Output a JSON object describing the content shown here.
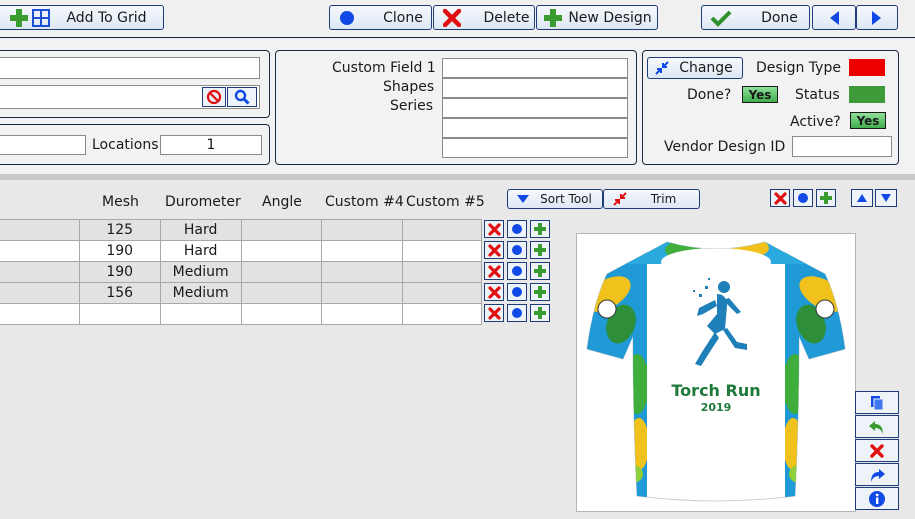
{
  "toolbar": {
    "add_to_grid": "Add To Grid",
    "clone": "Clone",
    "delete": "Delete",
    "new_design": "New Design",
    "done": "Done"
  },
  "form": {
    "locations_label": "Locations",
    "locations_value": "1",
    "custom_field_1_label": "Custom Field 1",
    "shapes_label": "Shapes",
    "series_label": "Series"
  },
  "design_panel": {
    "change_label": "Change",
    "design_type_label": "Design Type",
    "done_label": "Done?",
    "done_value": "Yes",
    "status_label": "Status",
    "active_label": "Active?",
    "active_value": "Yes",
    "vendor_design_id_label": "Vendor Design ID",
    "design_type_color": "#ee0000",
    "status_color": "#3f9a3a"
  },
  "grid": {
    "columns": [
      "Mesh",
      "Durometer",
      "Angle",
      "Custom #4",
      "Custom #5"
    ],
    "sort_tool_label": "Sort Tool",
    "trim_label": "Trim",
    "rows": [
      {
        "mesh": "125",
        "durometer": "Hard"
      },
      {
        "mesh": "190",
        "durometer": "Hard"
      },
      {
        "mesh": "190",
        "durometer": "Medium"
      },
      {
        "mesh": "156",
        "durometer": "Medium"
      },
      {
        "mesh": "",
        "durometer": ""
      }
    ]
  },
  "preview": {
    "shirt_title": "Torch Run",
    "shirt_year": "2019"
  }
}
